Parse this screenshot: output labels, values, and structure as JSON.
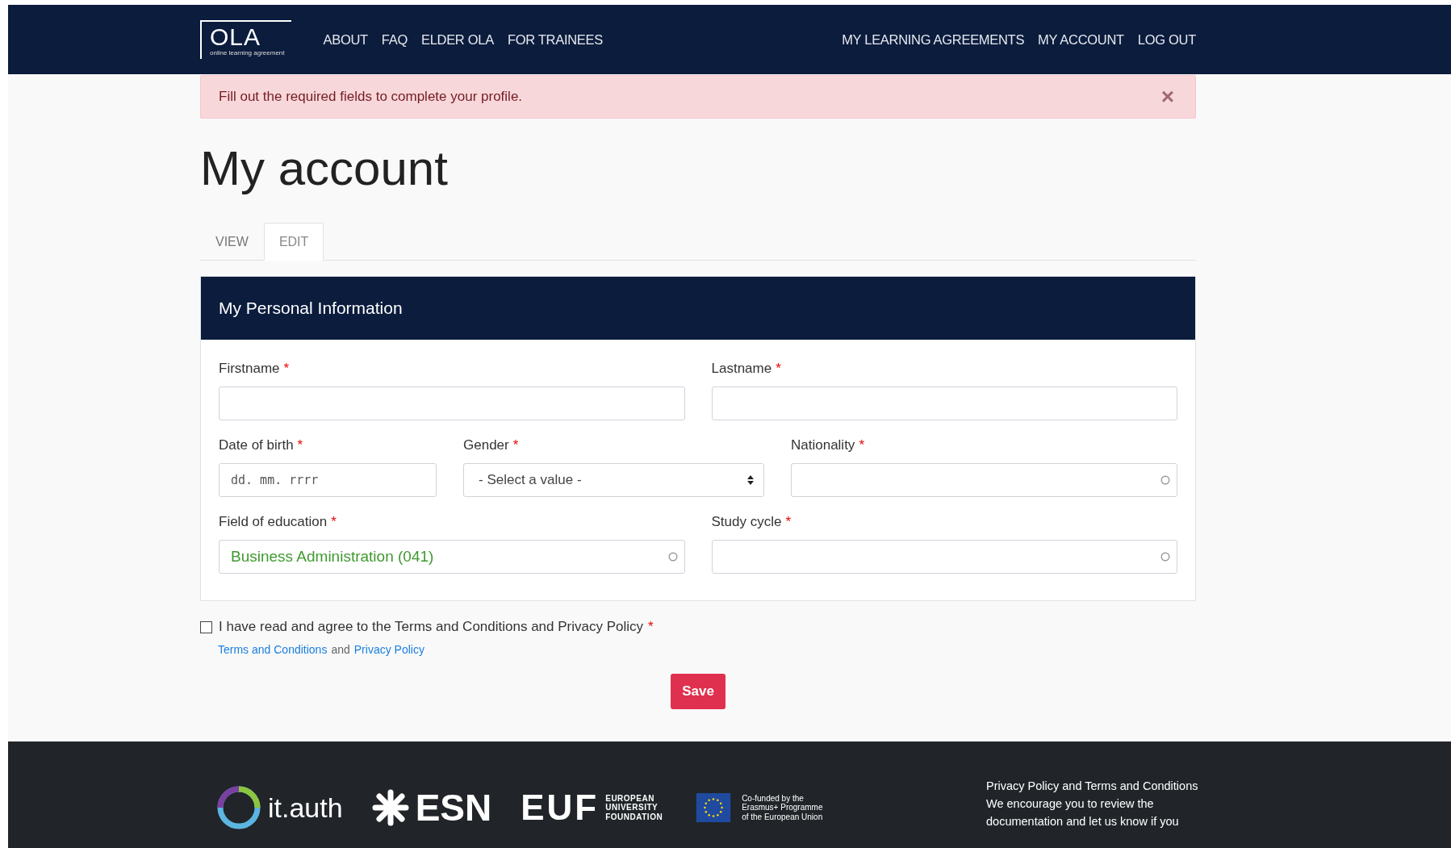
{
  "header": {
    "logo": {
      "text": "OLA",
      "tagline": "online learning agreement"
    },
    "nav_left": [
      "ABOUT",
      "FAQ",
      "ELDER OLA",
      "FOR TRAINEES"
    ],
    "nav_right": [
      "MY LEARNING AGREEMENTS",
      "MY ACCOUNT",
      "LOG OUT"
    ]
  },
  "alert": {
    "message": "Fill out the required fields to complete your profile.",
    "close": "×"
  },
  "page_title": "My account",
  "tabs": [
    {
      "label": "VIEW",
      "selected": false
    },
    {
      "label": "EDIT",
      "selected": true
    }
  ],
  "panel": {
    "title": "My Personal Information",
    "rows": [
      [
        {
          "label": "Firstname",
          "required_mark": "*",
          "kind": "text"
        },
        {
          "label": "Lastname",
          "required_mark": "*",
          "kind": "text"
        }
      ],
      [
        {
          "label": "Date of birth",
          "required_mark": "*",
          "kind": "date",
          "placeholder": "dd. mm. rrrr"
        },
        {
          "label": "Gender",
          "required_mark": "*",
          "kind": "select",
          "value": "- Select a value -"
        },
        {
          "label": "Nationality",
          "required_mark": "*",
          "kind": "autocomplete"
        }
      ],
      [
        {
          "label": "Field of education",
          "required_mark": "*",
          "kind": "autocomplete",
          "value": "Business Administration (041)"
        },
        {
          "label": "Study cycle",
          "required_mark": "*",
          "kind": "autocomplete"
        }
      ]
    ]
  },
  "agreement": {
    "checked": false,
    "label": "I have read and agree to the Terms and Conditions and Privacy Policy",
    "required_mark": "*",
    "links": [
      "Terms and Conditions",
      "Privacy Policy"
    ],
    "joiner": "and"
  },
  "save_button": "Save",
  "footer": {
    "logos": {
      "itauth": "it.auth",
      "esn": "ESN",
      "euf": "EUF",
      "euf_name": [
        "EUROPEAN",
        "UNIVERSITY",
        "FOUNDATION"
      ],
      "eu": [
        "Co-funded by the",
        "Erasmus+ Programme",
        "of the European Union"
      ]
    },
    "text": [
      "Privacy Policy and Terms and Conditions",
      "We encourage you to review the",
      "documentation and let us know if you"
    ]
  }
}
